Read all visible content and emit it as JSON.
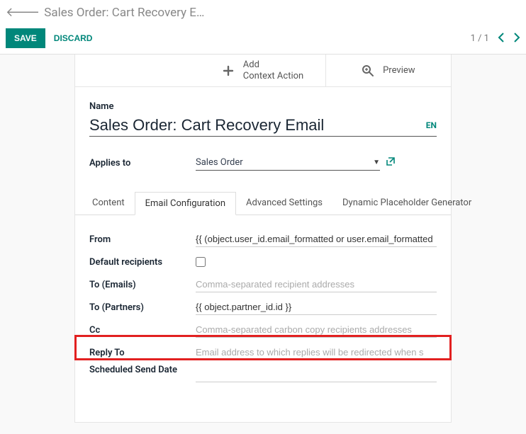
{
  "breadcrumb": {
    "title": "Sales Order: Cart Recovery E…"
  },
  "actions": {
    "save_label": "SAVE",
    "discard_label": "DISCARD"
  },
  "pager": {
    "text": "1 / 1"
  },
  "top_actions": {
    "add_line1": "Add",
    "add_line2": "Context Action",
    "preview": "Preview"
  },
  "form": {
    "name_label": "Name",
    "name_value": "Sales Order: Cart Recovery Email",
    "lang": "EN",
    "applies_label": "Applies to",
    "applies_value": "Sales Order"
  },
  "tabs": {
    "content": "Content",
    "email_config": "Email Configuration",
    "advanced": "Advanced Settings",
    "dynamic": "Dynamic Placeholder Generator"
  },
  "config": {
    "from_label": "From",
    "from_value": "{{ (object.user_id.email_formatted or user.email_formatted",
    "default_recipients_label": "Default recipients",
    "to_emails_label": "To (Emails)",
    "to_emails_placeholder": "Comma-separated recipient addresses",
    "to_partners_label": "To (Partners)",
    "to_partners_value": "{{ object.partner_id.id }}",
    "cc_label": "Cc",
    "cc_placeholder": "Comma-separated carbon copy recipients addresses",
    "reply_to_label": "Reply To",
    "reply_to_placeholder": "Email address to which replies will be redirected when s",
    "scheduled_label": "Scheduled Send Date"
  }
}
